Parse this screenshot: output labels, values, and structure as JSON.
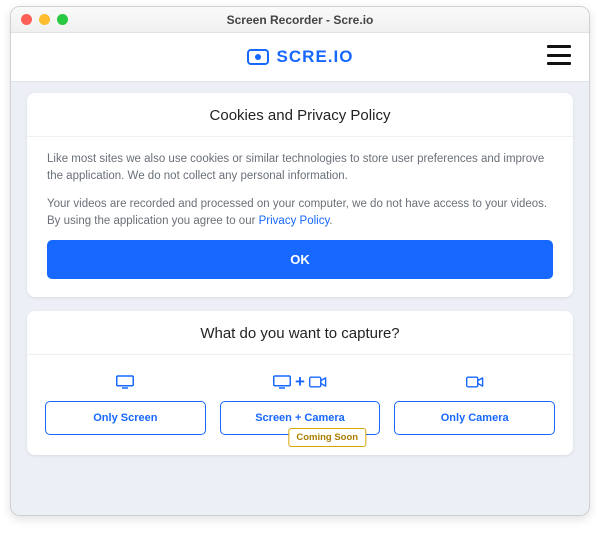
{
  "window": {
    "title": "Screen Recorder - Scre.io"
  },
  "brand": {
    "name": "SCRE.IO"
  },
  "policy": {
    "heading": "Cookies and Privacy Policy",
    "p1": "Like most sites we also use cookies or similar technologies to store user preferences and improve the application. We do not collect any personal information.",
    "p2a": "Your videos are recorded and processed on your computer, we do not have access to your videos. By using the application you agree to our ",
    "p2link": "Privacy Policy",
    "p2b": ".",
    "ok": "OK"
  },
  "capture": {
    "heading": "What do you want to capture?",
    "options": {
      "screen": {
        "label": "Only Screen"
      },
      "both": {
        "label": "Screen + Camera",
        "badge": "Coming Soon",
        "plus": "+"
      },
      "camera": {
        "label": "Only Camera"
      }
    }
  }
}
